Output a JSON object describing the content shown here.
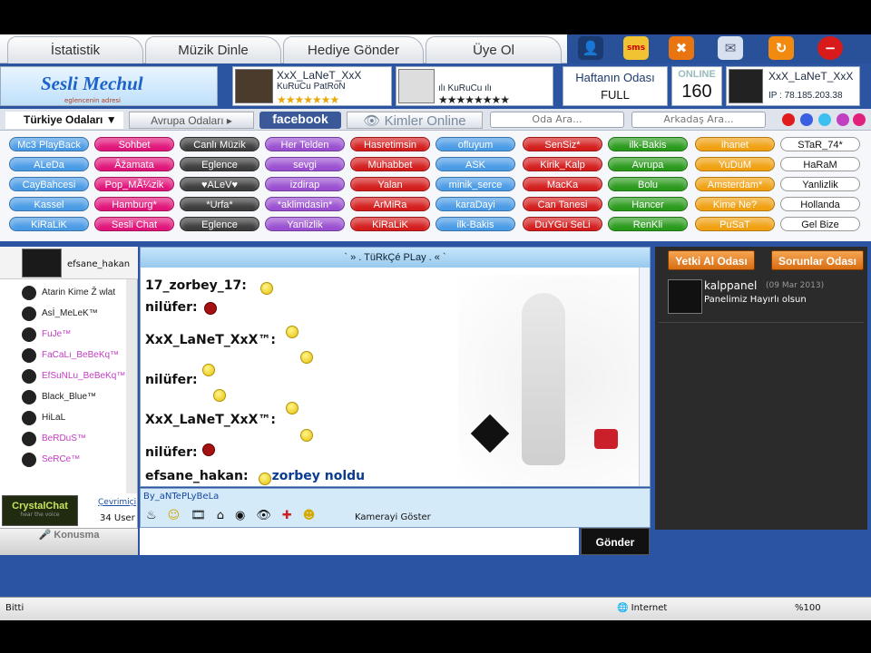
{
  "nav": {
    "tabs": [
      "İstatistik",
      "Müzik Dinle",
      "Hediye Gönder",
      "Üye Ol"
    ]
  },
  "header": {
    "logo_text": "Sesli Mechul",
    "logo_sub": "eglencenin adresi",
    "featured1": {
      "name": "XxX_LaNeT_XxX",
      "role": "KuRuCu PatRoN",
      "stars": "★★★★★★★"
    },
    "featured2": {
      "name": "ılı KuRuCu ılı",
      "stars": "★★★★★★★★"
    },
    "week_room": {
      "label": "Haftanın Odası",
      "value": "FULL"
    },
    "online": {
      "label": "ONLINE",
      "value": "160"
    },
    "user": {
      "name": "XxX_LaNeT_XxX",
      "ip": "IP : 78.185.203.38"
    }
  },
  "toolbar": {
    "turkey_rooms": "Türkiye Odaları ▼",
    "europe_rooms": "Avrupa Odaları ▸",
    "facebook": "facebook",
    "who_online": "Kimler Online",
    "room_search": "Oda Ara...",
    "friend_search": "Arkadaş Ara..."
  },
  "rooms": [
    [
      "Mc3 PlayBack",
      "Sohbet",
      "Canlı Müzik",
      "Her Telden",
      "Hasretimsin",
      "ofluyum",
      "SenSiz*",
      "ilk-Bakis",
      "ihanet",
      "STaR_74*"
    ],
    [
      "ALeDa",
      "Âžamata",
      "Eglence",
      "sevgi",
      "Muhabbet",
      "ASK",
      "Kirik_Kalp",
      "Avrupa",
      "YuDuM",
      "HaRaM"
    ],
    [
      "CayBahcesi",
      "Pop_MÃ¼zik",
      "♥ALeV♥",
      "izdirap",
      "Yalan",
      "minik_serce",
      "MacKa",
      "Bolu",
      "Amsterdam*",
      "Yanlizlik"
    ],
    [
      "Kassel",
      "Hamburg*",
      "*Urfa*",
      "*aklimdasin*",
      "ArMiRa",
      "karaDayi",
      "Can Tanesi",
      "Hancer",
      "Kime Ne?",
      "Hollanda"
    ],
    [
      "KiRaLiK",
      "Sesli Chat",
      "Eglence",
      "Yanlizlik",
      "KiRaLiK",
      "ilk-Bakis",
      "DuYGu SeLi",
      "RenKli",
      "PuSaT",
      "Gel Bize"
    ]
  ],
  "room_colors": [
    "#4a9be6",
    "#e0157a",
    "#3d3d3d",
    "#9a4fd0",
    "#d41e1e",
    "#4a9be6",
    "#d41e1e",
    "#2a9a1c",
    "#f0a010",
    "#ffffff"
  ],
  "sidebar": {
    "current_user": "efsane_hakan",
    "users": [
      "Atarin Kime Ž wlat",
      "Asİ_MeLeK™",
      "FuJe™",
      "FaCaLı_BeBeKq™",
      "EfSuNLu_BeBeKq™",
      "Black_Blue™",
      "HiLaL",
      "BeRDuS™",
      "SeRCe™"
    ],
    "user_colors": [
      "#222",
      "#222",
      "#c33cc3",
      "#c33cc3",
      "#c33cc3",
      "#222",
      "#222",
      "#c33cc3",
      "#c33cc3"
    ],
    "brand": "CrystalChat",
    "brand_sub": "hear the voice",
    "online_label": "Çevrimiçi",
    "user_count": "34 User",
    "talk_button": "Konusma"
  },
  "chat": {
    "title": "` » . TüRkÇé PLay . « `",
    "messages": [
      {
        "user": "17_zorbey_17:",
        "text": ""
      },
      {
        "user": "nilüfer:",
        "text": ""
      },
      {
        "user": "XxX_LaNeT_XxX™:",
        "text": ""
      },
      {
        "user": "nilüfer:",
        "text": ""
      },
      {
        "user": "XxX_LaNeT_XxX™:",
        "text": ""
      },
      {
        "user": "nilüfer:",
        "text": ""
      },
      {
        "user": "efsane_hakan:",
        "text": "zorbey noldu"
      }
    ],
    "signature": "By_aNTePLyBeLa",
    "camera_label": "Kamerayi Göster",
    "send_label": "Gönder"
  },
  "right": {
    "btn1": "Yetki Al Odası",
    "btn2": "Sorunlar Odası",
    "panel_user": "kalppanel",
    "panel_date": "(09 Mar 2013)",
    "panel_msg": "Panelimiz Hayırlı olsun"
  },
  "status": {
    "left": "Bitti",
    "zone": "Internet",
    "zoom": "%100"
  }
}
